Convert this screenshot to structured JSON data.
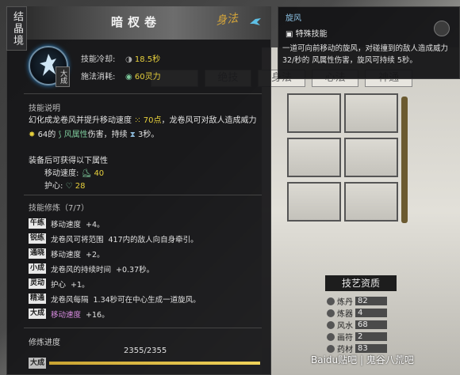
{
  "realm_badge": "结晶境",
  "skill": {
    "title": "暗杈卷",
    "calligraphy": "身法",
    "tier_tag": "大成",
    "stats": [
      {
        "label": "技能冷却:",
        "value": "18.5秒"
      },
      {
        "label": "施法消耗:",
        "value": "60灵力"
      }
    ]
  },
  "description": {
    "title": "技能说明",
    "line1_a": "幻化成龙卷风并提升移动速度",
    "line1_b": "70点",
    "line1_c": "，龙卷风可对敌人造成威力",
    "line2_a": "64的",
    "line2_b": "风属性",
    "line2_c": "伤害，持续",
    "line2_d": "3秒。"
  },
  "equip": {
    "title": "装备后可获得以下属性",
    "rows": [
      {
        "label": "移动速度:",
        "value": "40"
      },
      {
        "label": "护心:",
        "value": "28"
      }
    ]
  },
  "cultivation": {
    "title": "技能修炼（7/7）",
    "rows": [
      {
        "tag": "午练",
        "text": "移动速度",
        "value": "+4。"
      },
      {
        "tag": "锐练",
        "text": "龙卷风可将范围",
        "value": "417内的敌人向自身牵引。"
      },
      {
        "tag": "通晓",
        "text": "移动速度",
        "value": "+2。"
      },
      {
        "tag": "小成",
        "text": "龙卷风的持续时间",
        "value": "+0.37秒。"
      },
      {
        "tag": "灵动",
        "text": "护心",
        "value": "+1。"
      },
      {
        "tag": "精通",
        "text": "龙卷风每隔",
        "value": "1.34秒可在中心生成一道旋风。"
      },
      {
        "tag": "大成",
        "text": "移动速度",
        "value": "+16。"
      }
    ]
  },
  "progress": {
    "label": "修炼进度",
    "tag": "大成",
    "text": "2355/2355",
    "fraction": 1.0
  },
  "right_tooltip": {
    "title": "旋风",
    "sub": "特殊技能",
    "desc": "一道可向前移动的旋风，对碰撞到的敌人造成威力 32/秒的 风属性伤害，旋风可持续 5秒。"
  },
  "bg_tabs": [
    "",
    "绝技",
    "身法",
    "心法",
    "神通"
  ],
  "aptitude": {
    "title": "技艺资质",
    "rows": [
      {
        "label": "炼丹",
        "value": "82"
      },
      {
        "label": "炼器",
        "value": "4"
      },
      {
        "label": "风水",
        "value": "68"
      },
      {
        "label": "画符",
        "value": "2"
      },
      {
        "label": "药材",
        "value": "83"
      }
    ]
  },
  "watermark": "Baidu贴吧 | 鬼谷八荒吧"
}
